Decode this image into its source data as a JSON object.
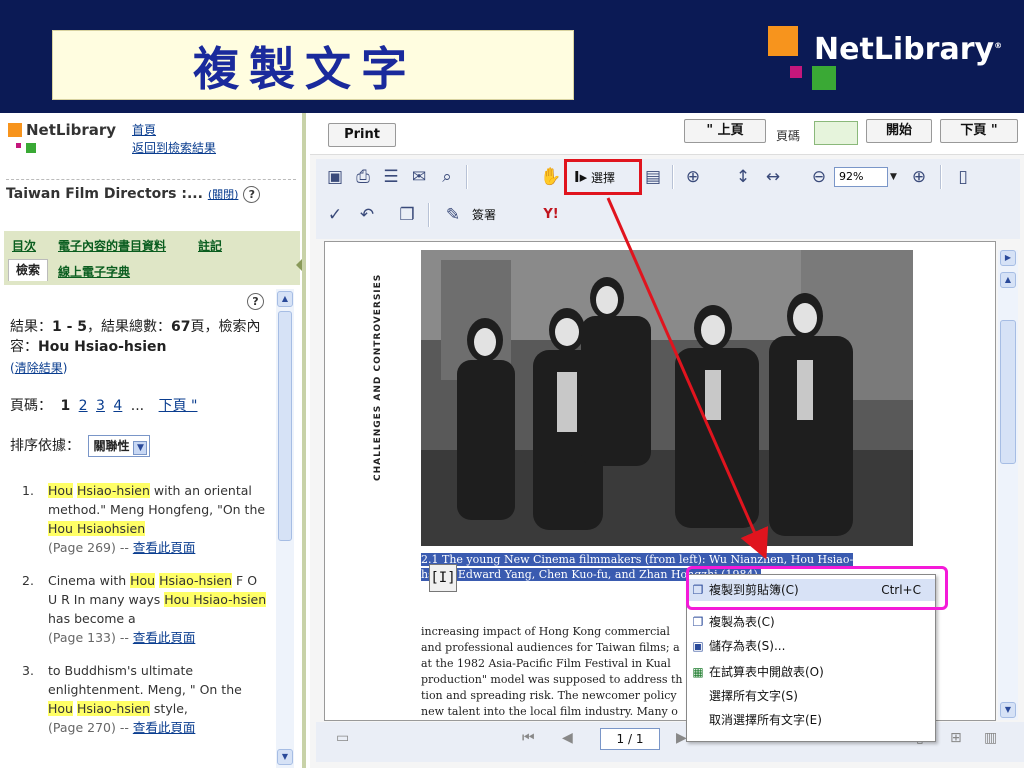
{
  "slide": {
    "title": "複製文字",
    "brand": "NetLibrary",
    "brand_reg": "®"
  },
  "left_pane": {
    "logo_name": "NetLibrary",
    "links": [
      "首頁",
      "返回到檢索結果"
    ],
    "book_title": "Taiwan Film Directors :...",
    "book_close": "(關閉)",
    "tabs": [
      "目次",
      "電子內容的書目資料",
      "註記",
      "線上電子字典"
    ],
    "active_tab": "檢索",
    "summary_prefix": "結果：",
    "summary_range": "1 - 5",
    "summary_mid": "，結果總數：",
    "summary_total": "67",
    "summary_suffix": "頁，檢索內容：",
    "summary_query": "Hou Hsiao-hsien",
    "clear_label": "清除結果",
    "pages_label": "頁碼：",
    "pages": [
      "1",
      "2",
      "3",
      "4",
      "...",
      "下頁 \""
    ],
    "sort_label": "排序依據：",
    "sort_value": "關聯性",
    "view_page_label": "查看此頁面",
    "items": [
      {
        "n": "1.",
        "pre": "",
        "hl1": "Hou",
        "mid1": " ",
        "hl2": "Hsiao-hsien",
        "text": " with an oriental method.\" Meng Hongfeng, \"On the ",
        "hl3": "Hou Hsiaohsien",
        "meta": "(Page 269) -- "
      },
      {
        "n": "2.",
        "pre": "Cinema with ",
        "hl1": "Hou",
        "mid1": " ",
        "hl2": "Hsiao-hsien",
        "text": " F O U R In many ways ",
        "hl3": "Hou Hsiao-hsien",
        "text2": " has become a",
        "meta": "(Page 133) -- "
      },
      {
        "n": "3.",
        "pre": "to Buddhism's ultimate enlightenment. Meng, \" On the ",
        "hl1": "Hou",
        "mid1": " ",
        "hl2": "Hsiao-hsien",
        "text": " style,",
        "meta": "(Page 270) -- "
      }
    ]
  },
  "nav": {
    "print": "Print",
    "prev": "\" 上頁",
    "page_label": "頁碼",
    "go": "開始",
    "next": "下頁 \""
  },
  "toolbar": {
    "select_label": "選擇",
    "zoom_value": "92%",
    "signature_label": "簽署"
  },
  "document": {
    "side_text": "CHALLENGES AND CONTROVERSIES",
    "caption": "2.1 The young New Cinema filmmakers (from left): Wu Nianzhen, Hou Hsiao-hsien, Edward Yang, Chen Kuo-fu, and Zhan Hongzhi (1984).",
    "body": [
      "increasing impact of Hong Kong commercial",
      "and professional audiences for Taiwan films; a",
      "at the 1982 Asia-Pacific Film Festival in Kual",
      "production\" model was supposed to address th",
      "tion and spreading risk. The newcomer policy",
      "new talent into the local film industry. Many o"
    ],
    "page_indicator": "1 / 1"
  },
  "context_menu": {
    "items": [
      {
        "label": "複製到剪貼簿(C)",
        "shortcut": "Ctrl+C",
        "icon": "copy-icon"
      },
      {
        "label": "複製為表(C)",
        "shortcut": "",
        "icon": "copy-table-icon"
      },
      {
        "label": "儲存為表(S)...",
        "shortcut": "",
        "icon": "save-icon"
      },
      {
        "label": "在試算表中開啟表(O)",
        "shortcut": "",
        "icon": "spreadsheet-icon"
      },
      {
        "label": "選擇所有文字(S)",
        "shortcut": "",
        "icon": ""
      },
      {
        "label": "取消選擇所有文字(E)",
        "shortcut": "",
        "icon": ""
      }
    ]
  },
  "colors": {
    "slide_bg": "#0b1a55",
    "title_text": "#1a2a9c",
    "highlight_red": "#e0141e",
    "highlight_magenta": "#f41ad8",
    "logo_orange": "#f7941d",
    "logo_green": "#3aa935",
    "logo_magenta": "#c4177c"
  }
}
